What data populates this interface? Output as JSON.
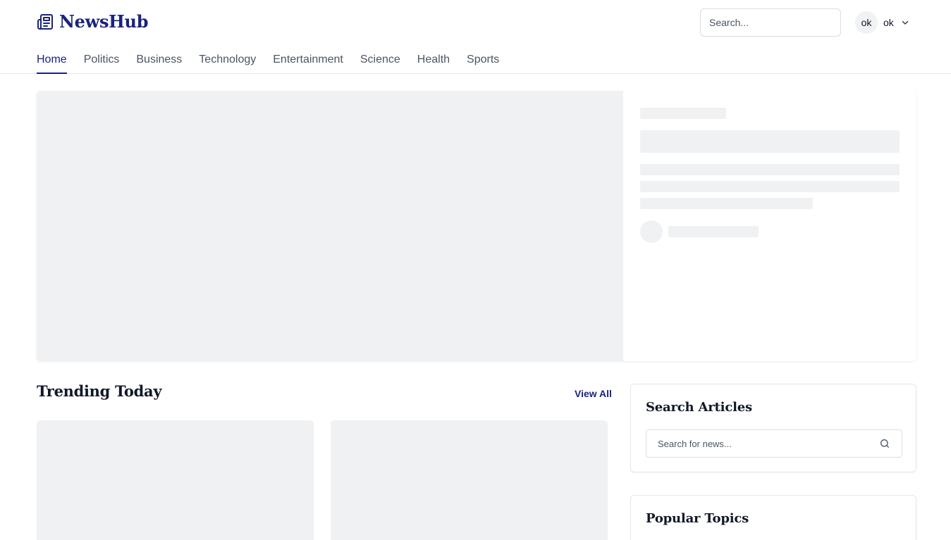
{
  "header": {
    "logo_text": "NewsHub",
    "logo_icon": "newspaper-icon",
    "search_placeholder": "Search...",
    "user_avatar": "ok",
    "user_name": "ok"
  },
  "nav": {
    "items": [
      {
        "label": "Home",
        "active": true
      },
      {
        "label": "Politics"
      },
      {
        "label": "Business"
      },
      {
        "label": "Technology"
      },
      {
        "label": "Entertainment"
      },
      {
        "label": "Science"
      },
      {
        "label": "Health"
      },
      {
        "label": "Sports"
      }
    ]
  },
  "trending": {
    "title": "Trending Today",
    "view_all": "View All"
  },
  "sidebar": {
    "search": {
      "title": "Search Articles",
      "placeholder": "Search for news..."
    },
    "topics": {
      "title": "Popular Topics"
    }
  },
  "colors": {
    "brand": "#1a237e",
    "skeleton": "#f0f1f3",
    "border": "#e5e7eb"
  }
}
